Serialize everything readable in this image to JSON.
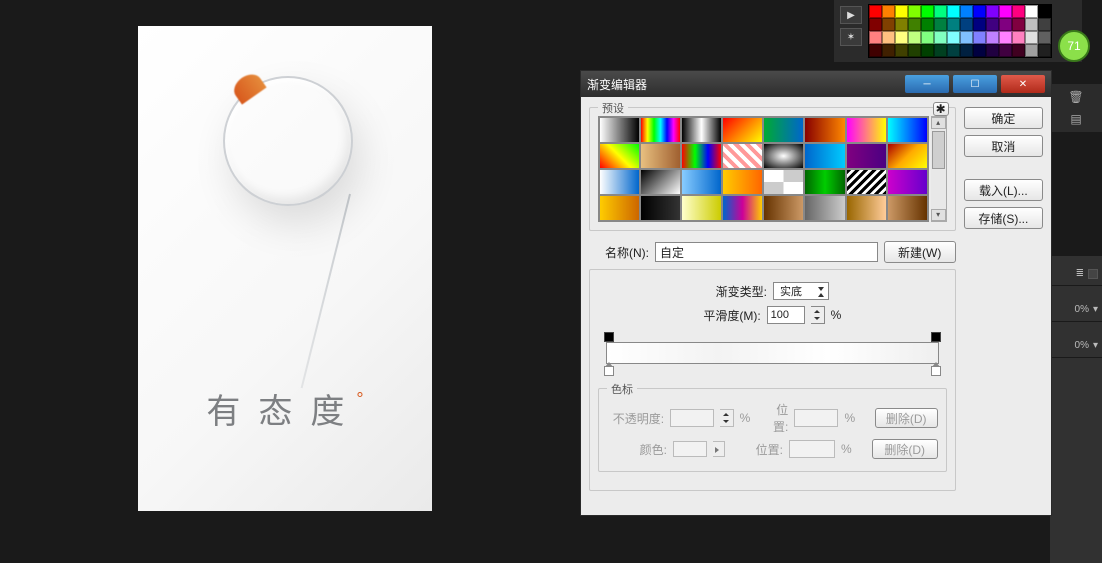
{
  "canvas": {
    "tagline_c1": "有",
    "tagline_c2": "态",
    "tagline_c3": "度",
    "tagline_sup": "°"
  },
  "palette": {
    "badge": "71"
  },
  "rdock": {
    "pct": "0%"
  },
  "dialog": {
    "title": "渐变编辑器",
    "buttons": {
      "ok": "确定",
      "cancel": "取消",
      "load": "载入(L)...",
      "save": "存储(S)...",
      "new": "新建(W)",
      "delete": "删除(D)"
    },
    "presets": {
      "legend": "预设"
    },
    "name": {
      "label": "名称(N):",
      "value": "自定"
    },
    "type": {
      "label": "渐变类型:",
      "value": "实底"
    },
    "smooth": {
      "label": "平滑度(M):",
      "value": "100",
      "unit": "%"
    },
    "stops": {
      "legend": "色标",
      "opacity_label": "不透明度:",
      "opacity_unit": "%",
      "pos_label": "位置:",
      "pos_unit": "%",
      "color_label": "颜色:"
    }
  },
  "swatch_colors": [
    "#ff0000",
    "#ff8000",
    "#ffff00",
    "#80ff00",
    "#00ff00",
    "#00ff80",
    "#00ffff",
    "#0080ff",
    "#0000ff",
    "#8000ff",
    "#ff00ff",
    "#ff0080",
    "#ffffff",
    "#000000",
    "#800000",
    "#804000",
    "#808000",
    "#408000",
    "#008000",
    "#008040",
    "#008080",
    "#004080",
    "#000080",
    "#400080",
    "#800080",
    "#800040",
    "#c0c0c0",
    "#404040",
    "#ff8080",
    "#ffc080",
    "#ffff80",
    "#c0ff80",
    "#80ff80",
    "#80ffc0",
    "#80ffff",
    "#80c0ff",
    "#8080ff",
    "#c080ff",
    "#ff80ff",
    "#ff80c0",
    "#e0e0e0",
    "#606060",
    "#400000",
    "#402000",
    "#404000",
    "#204000",
    "#004000",
    "#004020",
    "#004040",
    "#002040",
    "#000040",
    "#200040",
    "#400040",
    "#400020",
    "#a0a0a0",
    "#202020"
  ],
  "preset_gradients": [
    "linear-gradient(90deg,#fff,#000)",
    "linear-gradient(90deg,#f00,#ff0,#0f0,#0ff,#00f,#f0f,#f00)",
    "linear-gradient(90deg,#000,#fff,#000)",
    "linear-gradient(135deg,#f00,#ff0)",
    "linear-gradient(90deg,#0a3,#06c)",
    "linear-gradient(90deg,#800,#f80)",
    "linear-gradient(90deg,#f0f,#ff0)",
    "linear-gradient(90deg,#0ff,#00f)",
    "linear-gradient(45deg,#f00,#ff0,#0f0)",
    "linear-gradient(90deg,#e8c080,#a06030)",
    "linear-gradient(90deg,#f00,#0f0,#00f,#f00)",
    "repeating-linear-gradient(45deg,#f99,#f99 4px,#fff 4px,#fff 8px)",
    "radial-gradient(#fff,#000)",
    "linear-gradient(90deg,#06c,#0cf)",
    "linear-gradient(90deg,#800080,#4b0082)",
    "linear-gradient(135deg,#a00,#fa0,#ff0)",
    "linear-gradient(90deg,#fff,#06c)",
    "linear-gradient(135deg,#000,#fff)",
    "linear-gradient(90deg,#8cf,#06c)",
    "linear-gradient(90deg,#fc0,#f60)",
    "repeating-conic-gradient(#ccc 0 25%,#fff 0 50%)",
    "linear-gradient(90deg,#060,#0c0,#060)",
    "repeating-linear-gradient(135deg,#000,#000 3px,#fff 3px,#fff 6px)",
    "linear-gradient(90deg,#c0c,#60c)",
    "linear-gradient(90deg,#fc0,#c60)",
    "linear-gradient(90deg,#000,#333)",
    "linear-gradient(90deg,#ffc,#cc0)",
    "linear-gradient(90deg,#06c,#c09,#fc0)",
    "linear-gradient(90deg,#630,#c96)",
    "linear-gradient(90deg,#666,#ccc)",
    "linear-gradient(90deg,#960,#fc9)",
    "linear-gradient(90deg,#c96,#630)"
  ]
}
